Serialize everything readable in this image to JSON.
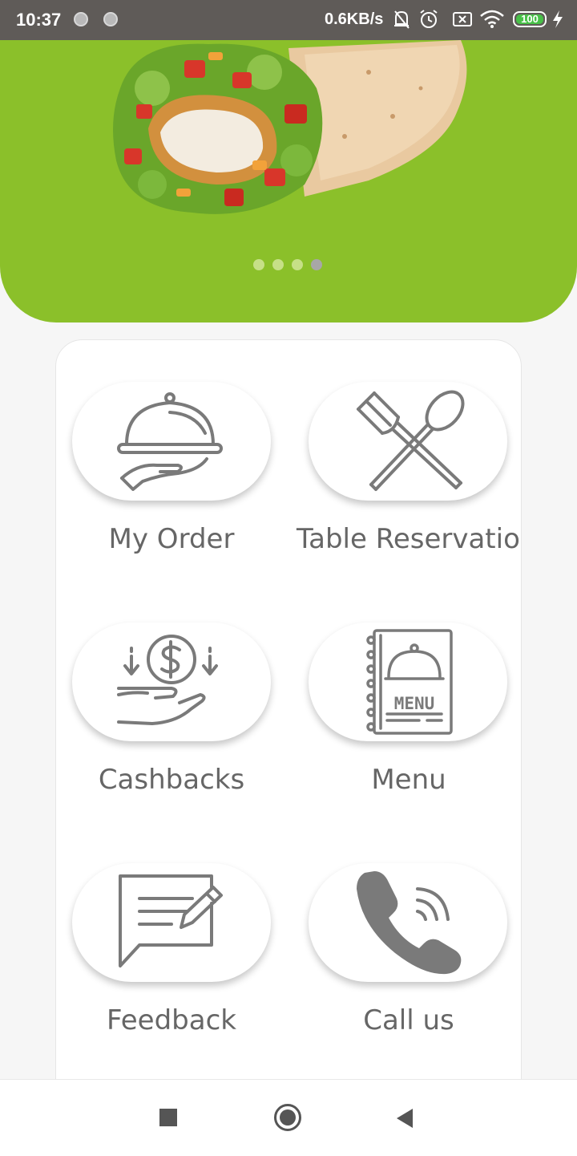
{
  "status_bar": {
    "time": "10:37",
    "network_speed": "0.6KB/s",
    "battery_level": "100",
    "icons": [
      "notification-dot-icon",
      "notification-dot-icon",
      "bell-off-icon",
      "alarm-icon",
      "sim-icon",
      "wifi-icon",
      "battery-icon",
      "charging-icon"
    ]
  },
  "banner": {
    "image": "chicken-wrap-photo",
    "background_color": "#8bc02a",
    "slide_count": 4,
    "active_slide": 4
  },
  "menu": {
    "items": [
      {
        "label": "My Order",
        "icon": "serving-cloche-hand-icon"
      },
      {
        "label": "Table Reservatio",
        "icon": "fork-spoon-icon"
      },
      {
        "label": "Cashbacks",
        "icon": "cashback-hand-icon"
      },
      {
        "label": "Menu",
        "icon": "menu-book-icon"
      },
      {
        "label": "Feedback",
        "icon": "feedback-chat-icon"
      },
      {
        "label": "Call us",
        "icon": "phone-call-icon"
      }
    ]
  },
  "nav_bar": {
    "buttons": [
      "recent-apps-icon",
      "home-icon",
      "back-icon"
    ]
  },
  "colors": {
    "accent": "#8bc02a",
    "icon_gray": "#7a7a7a",
    "label_gray": "#666666"
  }
}
